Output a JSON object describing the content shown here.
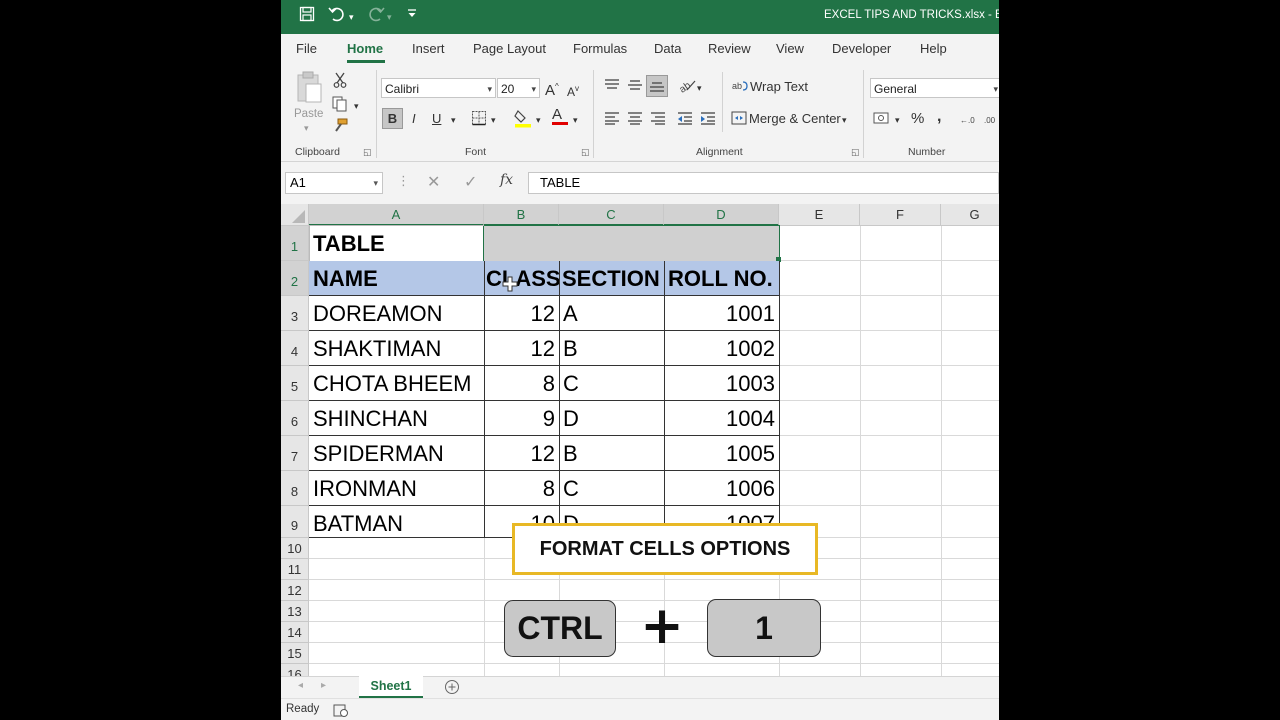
{
  "window": {
    "title": "EXCEL TIPS AND TRICKS.xlsx  -  Ex"
  },
  "menu": {
    "tabs": [
      "File",
      "Home",
      "Insert",
      "Page Layout",
      "Formulas",
      "Data",
      "Review",
      "View",
      "Developer",
      "Help"
    ],
    "active": "Home"
  },
  "ribbon": {
    "clipboard": {
      "label": "Clipboard",
      "paste": "Paste"
    },
    "font": {
      "label": "Font",
      "name": "Calibri",
      "size": "20",
      "bold": "B",
      "italic": "I",
      "underline": "U"
    },
    "alignment": {
      "label": "Alignment",
      "wrap_text": "Wrap Text",
      "merge_center": "Merge & Center"
    },
    "number": {
      "label": "Number",
      "format": "General"
    }
  },
  "formula_bar": {
    "name_box": "A1",
    "fx": "fx",
    "content": "TABLE"
  },
  "grid": {
    "columns": [
      "A",
      "B",
      "C",
      "D",
      "E",
      "F",
      "G"
    ],
    "rows": [
      "1",
      "2",
      "3",
      "4",
      "5",
      "6",
      "7",
      "8",
      "9",
      "10",
      "11",
      "12",
      "13",
      "14",
      "15",
      "16"
    ],
    "table": {
      "title": "TABLE",
      "headers": [
        "NAME",
        "CLASS",
        "SECTION",
        "ROLL NO."
      ],
      "rows": [
        [
          "DOREAMON",
          "12",
          "A",
          "1001"
        ],
        [
          "SHAKTIMAN",
          "12",
          "B",
          "1002"
        ],
        [
          "CHOTA BHEEM",
          "8",
          "C",
          "1003"
        ],
        [
          "SHINCHAN",
          "9",
          "D",
          "1004"
        ],
        [
          "SPIDERMAN",
          "12",
          "B",
          "1005"
        ],
        [
          "IRONMAN",
          "8",
          "C",
          "1006"
        ],
        [
          "BATMAN",
          "10",
          "D",
          "1007"
        ]
      ]
    }
  },
  "overlay": {
    "caption": "FORMAT CELLS OPTIONS",
    "key1": "CTRL",
    "plus": "+",
    "key2": "1"
  },
  "sheets": {
    "active": "Sheet1"
  },
  "status": {
    "text": "Ready"
  },
  "colors": {
    "excel_green": "#217346",
    "header_fill": "#b4c7e7",
    "title_fill": "#d0d0d0",
    "caption_border": "#e8b825"
  }
}
